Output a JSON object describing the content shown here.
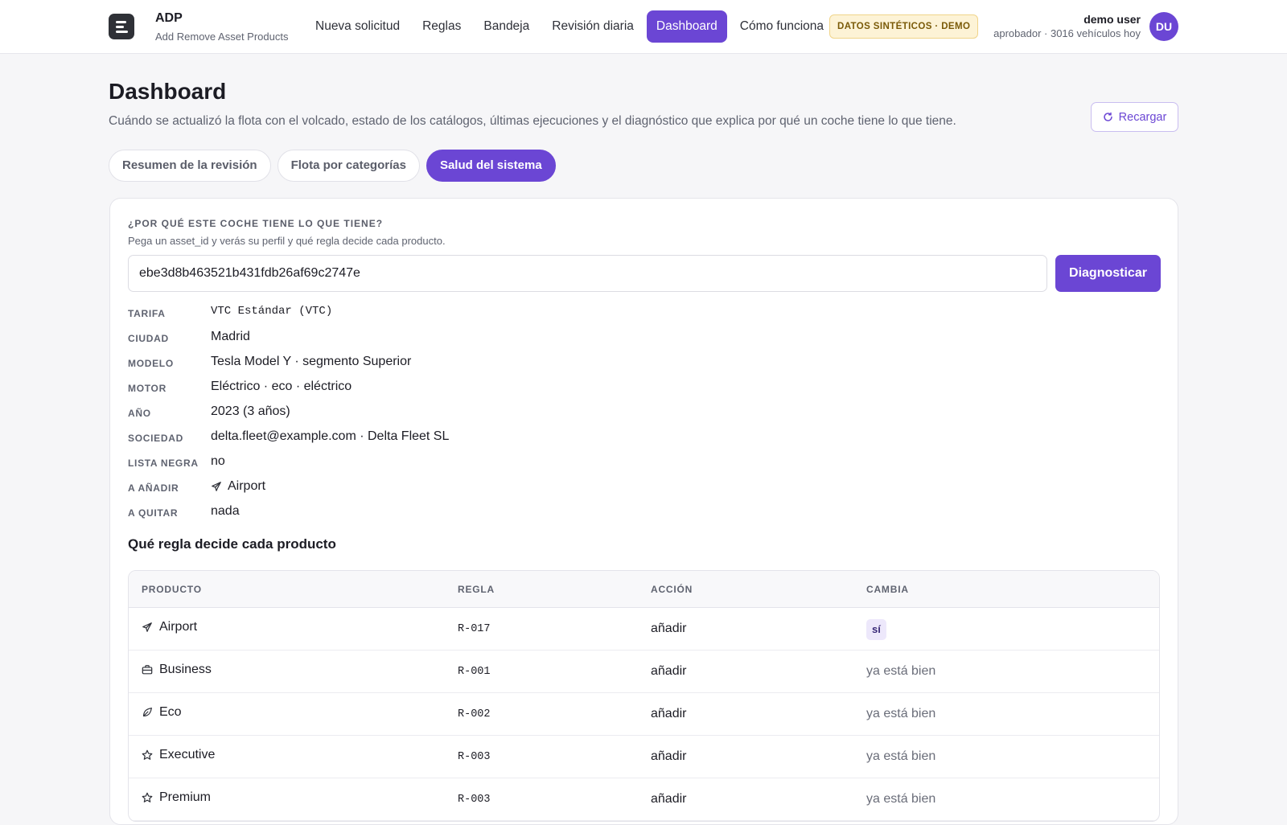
{
  "app": {
    "title": "ADP",
    "subtitle": "Add Remove Asset Products"
  },
  "nav": {
    "items": [
      {
        "label": "Nueva solicitud",
        "active": false
      },
      {
        "label": "Reglas",
        "active": false
      },
      {
        "label": "Bandeja",
        "active": false
      },
      {
        "label": "Revisión diaria",
        "active": false
      },
      {
        "label": "Dashboard",
        "active": true
      },
      {
        "label": "Cómo funciona",
        "active": false
      }
    ]
  },
  "header": {
    "demo_badge": "DATOS SINTÉTICOS · DEMO",
    "user_name": "demo user",
    "user_meta": "aprobador · 3016 vehículos hoy",
    "avatar_initials": "DU"
  },
  "page": {
    "title": "Dashboard",
    "description": "Cuándo se actualizó la flota con el volcado, estado de los catálogos, últimas ejecuciones y el diagnóstico que explica por qué un coche tiene lo que tiene.",
    "reload_label": "Recargar"
  },
  "tabs": [
    {
      "label": "Resumen de la revisión",
      "active": false
    },
    {
      "label": "Flota por categorías",
      "active": false
    },
    {
      "label": "Salud del sistema",
      "active": true
    }
  ],
  "diagnostic": {
    "kicker": "¿POR QUÉ ESTE COCHE TIENE LO QUE TIENE?",
    "help": "Pega un asset_id y verás su perfil y qué regla decide cada producto.",
    "asset_id_value": "ebe3d8b463521b431fdb26af69c2747e",
    "button_label": "Diagnosticar"
  },
  "profile": {
    "tarifa_label": "TARIFA",
    "tarifa": "VTC Estándar (VTC)",
    "ciudad_label": "CIUDAD",
    "ciudad": "Madrid",
    "modelo_label": "MODELO",
    "modelo": "Tesla Model Y · segmento Superior",
    "motor_label": "MOTOR",
    "motor": "Eléctrico · eco · eléctrico",
    "anio_label": "AÑO",
    "anio": "2023 (3 años)",
    "sociedad_label": "SOCIEDAD",
    "sociedad": "delta.fleet@example.com · Delta Fleet SL",
    "lista_negra_label": "LISTA NEGRA",
    "lista_negra": "no",
    "anadir_label": "A AÑADIR",
    "anadir": "Airport",
    "anadir_icon": "plane-icon",
    "quitar_label": "A QUITAR",
    "quitar": "nada"
  },
  "rules": {
    "title": "Qué regla decide cada producto",
    "headers": {
      "producto": "PRODUCTO",
      "regla": "REGLA",
      "accion": "ACCIÓN",
      "cambia": "CAMBIA"
    },
    "rows": [
      {
        "producto": "Airport",
        "icon": "plane-icon",
        "regla": "R-017",
        "accion": "añadir",
        "cambia": "sí",
        "cambia_badge": true
      },
      {
        "producto": "Business",
        "icon": "briefcase-icon",
        "regla": "R-001",
        "accion": "añadir",
        "cambia": "ya está bien",
        "cambia_badge": false
      },
      {
        "producto": "Eco",
        "icon": "leaf-icon",
        "regla": "R-002",
        "accion": "añadir",
        "cambia": "ya está bien",
        "cambia_badge": false
      },
      {
        "producto": "Executive",
        "icon": "star-icon",
        "regla": "R-003",
        "accion": "añadir",
        "cambia": "ya está bien",
        "cambia_badge": false
      },
      {
        "producto": "Premium",
        "icon": "star-icon",
        "regla": "R-003",
        "accion": "añadir",
        "cambia": "ya está bien",
        "cambia_badge": false
      }
    ]
  },
  "colors": {
    "accent": "#6b46d4",
    "badge_bg": "#fdf3d6",
    "badge_text": "#7a5a08"
  }
}
